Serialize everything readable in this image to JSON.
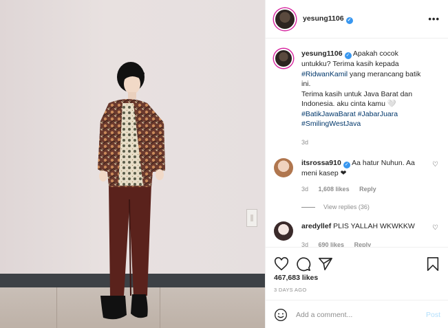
{
  "post": {
    "username": "yesung1106",
    "more_label": "•••"
  },
  "caption": {
    "username": "yesung1106",
    "text_1": "Apakah cocok untukku? Terima kasih kepada ",
    "tag_1": "#RidwanKamil",
    "text_2": " yang merancang batik ini.",
    "text_3": "Terima kasih untuk Java Barat dan Indonesia. aku cinta kamu 🤍",
    "tag_2": "#BatikJawaBarat",
    "tag_3": "#JabarJuara",
    "tag_4": "#SmilingWestJava",
    "age": "3d"
  },
  "comments": [
    {
      "username": "itsrossa910",
      "text": "Aa hatur Nuhun. Aa meni kasep ❤",
      "age": "3d",
      "likes": "1,608 likes",
      "reply": "Reply",
      "view_replies": "View replies (36)"
    },
    {
      "username": "aredyllef",
      "text": "PLIS YALLAH WKWKKW",
      "age": "3d",
      "likes": "690 likes",
      "reply": "Reply"
    }
  ],
  "stats": {
    "likes": "467,683 likes",
    "date": "3 DAYS AGO"
  },
  "add_comment": {
    "placeholder": "Add a comment...",
    "post_label": "Post"
  },
  "colors": {
    "link": "#00376b",
    "verified": "#3897f0",
    "muted": "#8e8e8e",
    "post_disabled": "#b2dffc"
  }
}
